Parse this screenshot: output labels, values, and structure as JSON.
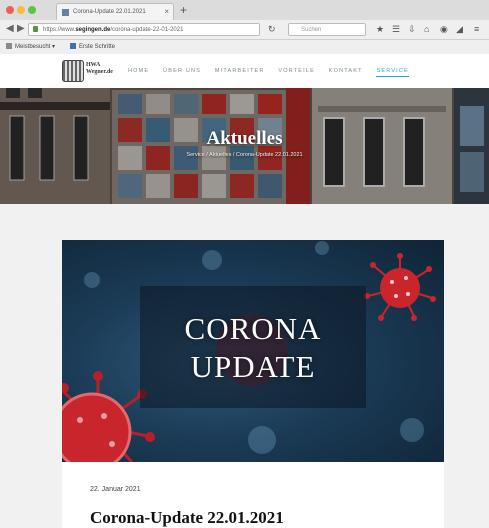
{
  "browser": {
    "tab_title": "Corona-Update 22.01.2021",
    "url_prefix": "https://www.",
    "url_domain": "segingen.de",
    "url_path": "/corona-update-22-01-2021",
    "search_placeholder": "Suchen",
    "bookmarks": [
      {
        "label": "Meistbesucht"
      },
      {
        "label": "Erste Schritte"
      }
    ]
  },
  "site": {
    "logo_text_line1": "HWA",
    "logo_text_line2": "Wegner.de",
    "menu": [
      "HOME",
      "ÜBER UNS",
      "MITARBEITER",
      "VORTEILE",
      "KONTAKT",
      "SERVICE"
    ],
    "active_menu": "SERVICE"
  },
  "hero": {
    "title": "Aktuelles",
    "breadcrumb": "Service / Aktuelles / Corona-Update 22.01.2021"
  },
  "post": {
    "image_text_line1": "CORONA",
    "image_text_line2": "UPDATE",
    "date": "22. Januar 2021",
    "title": "Corona-Update 22.01.2021"
  },
  "colors": {
    "menu_active": "#2aa3d8",
    "virus_red": "#c8262c",
    "image_blue": "#1b3b56"
  }
}
